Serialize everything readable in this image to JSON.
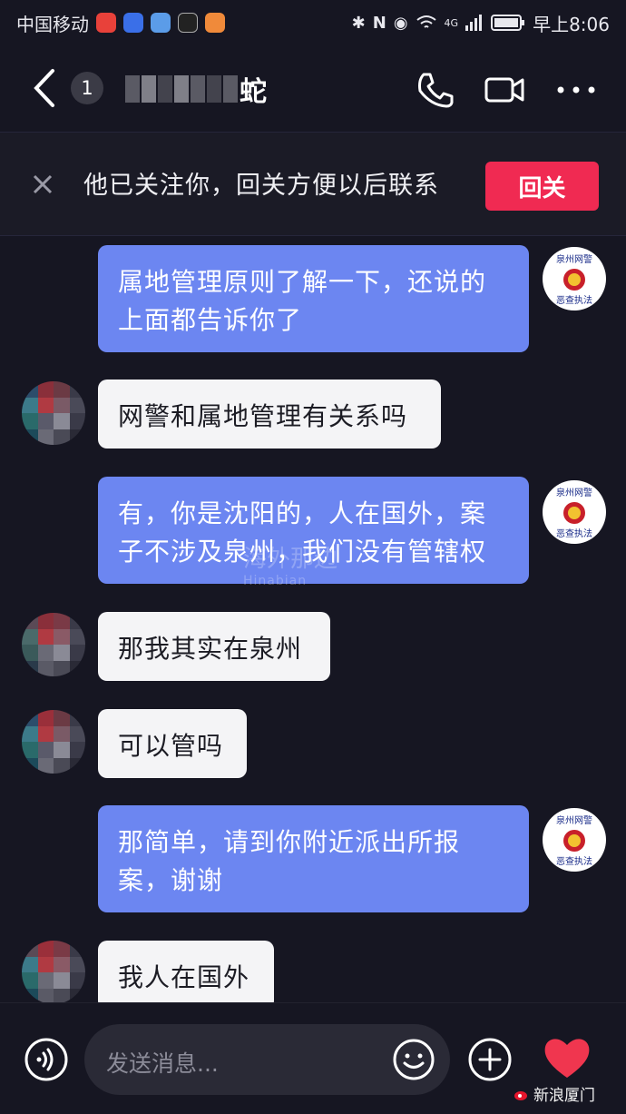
{
  "status_bar": {
    "carrier": "中国移动",
    "network": "4G",
    "time": "早上8:06",
    "app_icons": [
      "weibo-icon",
      "baidu-icon",
      "browser-icon",
      "capcut-icon",
      "video-icon"
    ],
    "system_icons": [
      "bluetooth-icon",
      "nfc-icon",
      "eye-icon",
      "wifi-icon",
      "signal-icon",
      "battery-icon"
    ]
  },
  "header": {
    "unread_count": "1",
    "contact_name_visible": "蛇",
    "icons": [
      "back-chevron-icon",
      "phone-icon",
      "video-call-icon",
      "more-icon"
    ]
  },
  "follow_banner": {
    "text": "他已关注你，回关方便以后联系",
    "button": "回关"
  },
  "messages": [
    {
      "sender": "me",
      "lines": [
        "属地管理原则了解一下，还说的",
        "上面都告诉你了"
      ]
    },
    {
      "sender": "other",
      "lines": [
        "网警和属地管理有关系吗"
      ]
    },
    {
      "sender": "me",
      "lines": [
        "有，你是沈阳的，人在国外，案",
        "子不涉及泉州，我们没有管辖权"
      ]
    },
    {
      "sender": "other",
      "lines": [
        "那我其实在泉州"
      ]
    },
    {
      "sender": "other",
      "lines": [
        "可以管吗"
      ]
    },
    {
      "sender": "me",
      "lines": [
        "那简单，请到你附近派出所报",
        "案，谢谢"
      ]
    },
    {
      "sender": "other",
      "lines": [
        "我人在国外"
      ]
    }
  ],
  "police_avatar": {
    "top_text": "泉州网警",
    "bottom_text": "恶查执法"
  },
  "watermark": {
    "text": "海外那边",
    "sub": "Hinabian"
  },
  "input_bar": {
    "placeholder": "发送消息..."
  },
  "source_mark": "新浪厦门",
  "colors": {
    "bg": "#161622",
    "my_bubble": "#6c86f1",
    "other_bubble": "#f4f4f6",
    "follow_button": "#f02a52",
    "heart": "#f0364f"
  }
}
